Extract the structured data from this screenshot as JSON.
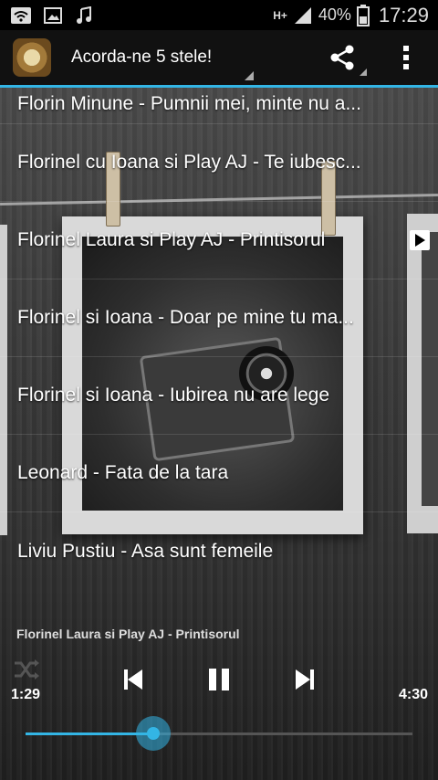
{
  "status_bar": {
    "battery_percent": "40%",
    "time": "17:29",
    "network": "H+",
    "icons": [
      "wifi-icon",
      "image-icon",
      "music-note-icon",
      "signal-icon",
      "battery-icon"
    ]
  },
  "action_bar": {
    "title": "Acorda-ne 5 stele!",
    "icons": [
      "app-logo-icon",
      "share-icon",
      "overflow-menu-icon"
    ]
  },
  "songs": [
    {
      "label": "Florin Minune - Pumnii mei, minte nu a..."
    },
    {
      "label": "Florinel cu Ioana si Play AJ - Te iubesc..."
    },
    {
      "label": "Florinel Laura si Play AJ - Printisorul",
      "playing": true
    },
    {
      "label": "Florinel si Ioana - Doar pe mine tu ma..."
    },
    {
      "label": "Florinel si Ioana - Iubirea nu are lege"
    },
    {
      "label": "Leonard - Fata de la tara"
    },
    {
      "label": "Liviu Pustiu - Asa sunt femeile"
    }
  ],
  "player": {
    "now_playing": "Florinel Laura si Play AJ - Printisorul",
    "elapsed": "1:29",
    "duration": "4:30",
    "progress_fraction": 0.33,
    "controls": [
      "shuffle-icon",
      "previous-icon",
      "pause-icon",
      "next-icon"
    ]
  },
  "colors": {
    "accent": "#33b5e5",
    "action_bar_bg": "#111111",
    "status_bar_bg": "#000000"
  }
}
